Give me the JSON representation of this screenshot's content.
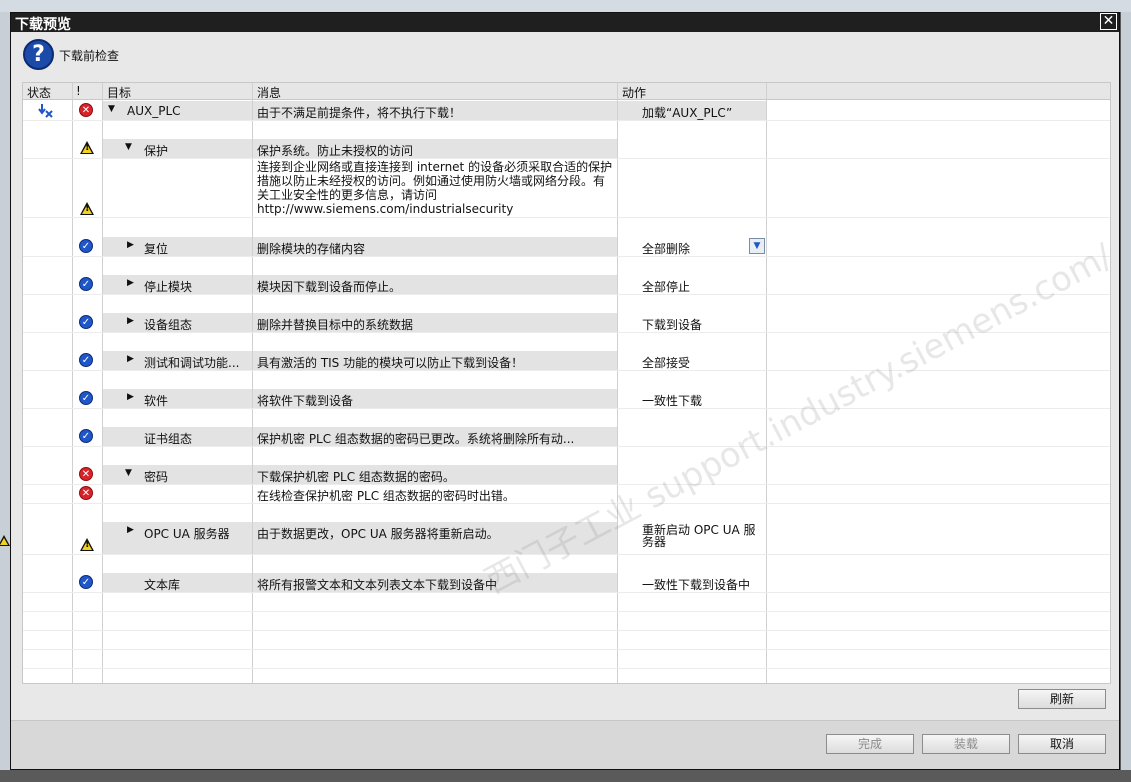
{
  "dialog": {
    "title": "下载预览",
    "close_glyph": "✕",
    "header_text": "下载前检查"
  },
  "columns": {
    "status": "状态",
    "flag": "!",
    "target": "目标",
    "message": "消息",
    "action": "动作"
  },
  "rows": {
    "r0": {
      "target": "AUX_PLC",
      "message": "由于不满足前提条件，将不执行下载！",
      "action": "加载“AUX_PLC”"
    },
    "r1": {
      "target": "保护",
      "message": "保护系统。防止未授权的访问"
    },
    "r2": {
      "message": "连接到企业网络或直接连接到 internet 的设备必须采取合适的保护措施以防止未经授权的访问。例如通过使用防火墙或网络分段。有关工业安全性的更多信息，请访问 http://www.siemens.com/industrialsecurity"
    },
    "r3": {
      "target": "复位",
      "message": "删除模块的存储内容",
      "action": "全部删除"
    },
    "r4": {
      "target": "停止模块",
      "message": "模块因下载到设备而停止。",
      "action": "全部停止"
    },
    "r5": {
      "target": "设备组态",
      "message": "删除并替换目标中的系统数据",
      "action": "下载到设备"
    },
    "r6": {
      "target": "测试和调试功能...",
      "message": "具有激活的 TIS 功能的模块可以防止下载到设备！",
      "action": "全部接受"
    },
    "r7": {
      "target": "软件",
      "message": "将软件下载到设备",
      "action": "一致性下载"
    },
    "r8": {
      "target": "证书组态",
      "message": "保护机密 PLC 组态数据的密码已更改。系统将删除所有动..."
    },
    "r9": {
      "target": "密码",
      "message": "下载保护机密 PLC 组态数据的密码。"
    },
    "r10": {
      "message": "在线检查保护机密 PLC 组态数据的密码时出错。"
    },
    "r11": {
      "target": "OPC UA 服务器",
      "message": "由于数据更改，OPC UA 服务器将重新启动。",
      "action": "重新启动 OPC UA 服务器"
    },
    "r12": {
      "target": "文本库",
      "message": "将所有报警文本和文本列表文本下载到设备中",
      "action": "一致性下载到设备中"
    }
  },
  "buttons": {
    "refresh": "刷新",
    "finish": "完成",
    "load": "装载",
    "cancel": "取消"
  },
  "watermark": "西门子工业 support.industry.siemens.com/cs"
}
